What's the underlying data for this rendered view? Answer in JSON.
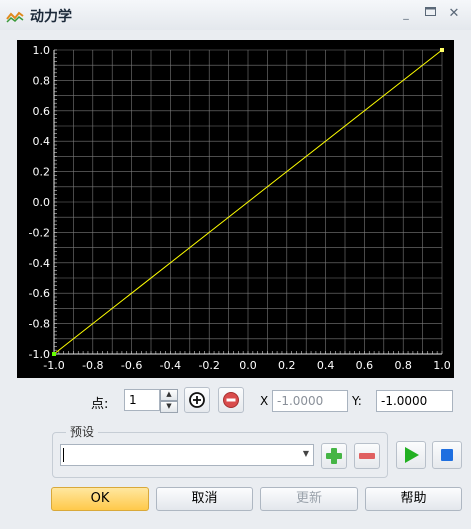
{
  "window": {
    "title": "动力学",
    "controls": [
      "minimize-icon",
      "maximize-icon",
      "close-icon"
    ]
  },
  "chart_data": {
    "type": "line",
    "series": [
      {
        "x": [
          -1.0,
          1.0
        ],
        "y": [
          -1.0,
          1.0
        ],
        "color": "#ffff00"
      }
    ],
    "points": [
      {
        "x": -1.0,
        "y": -1.0,
        "color": "#66ff00"
      },
      {
        "x": 1.0,
        "y": 1.0,
        "color": "#ffff66"
      }
    ],
    "xlim": [
      -1.0,
      1.0
    ],
    "ylim": [
      -1.0,
      1.0
    ],
    "x_ticks": [
      "-1.0",
      "-0.8",
      "-0.6",
      "-0.4",
      "-0.2",
      "0.0",
      "0.2",
      "0.4",
      "0.6",
      "0.8",
      "1.0"
    ],
    "y_ticks": [
      "1.0",
      "0.8",
      "0.6",
      "0.4",
      "0.2",
      "0.0",
      "-0.2",
      "-0.4",
      "-0.6",
      "-0.8",
      "-1.0"
    ],
    "grid": true,
    "background": "#000000"
  },
  "point_editor": {
    "label": "点:",
    "index_value": "1",
    "add_icon": "plus-circle-icon",
    "remove_icon": "minus-circle-icon",
    "x_label": "X",
    "x_value": "-1.0000",
    "y_label": "Y:",
    "y_value": "-1.0000"
  },
  "preset": {
    "group_label": "预设",
    "value": "",
    "add_icon": "green-plus-icon",
    "remove_icon": "red-minus-icon",
    "play_icon": "play-icon",
    "stop_icon": "stop-icon"
  },
  "buttons": {
    "ok": "OK",
    "cancel": "取消",
    "update": "更新",
    "help": "帮助"
  }
}
